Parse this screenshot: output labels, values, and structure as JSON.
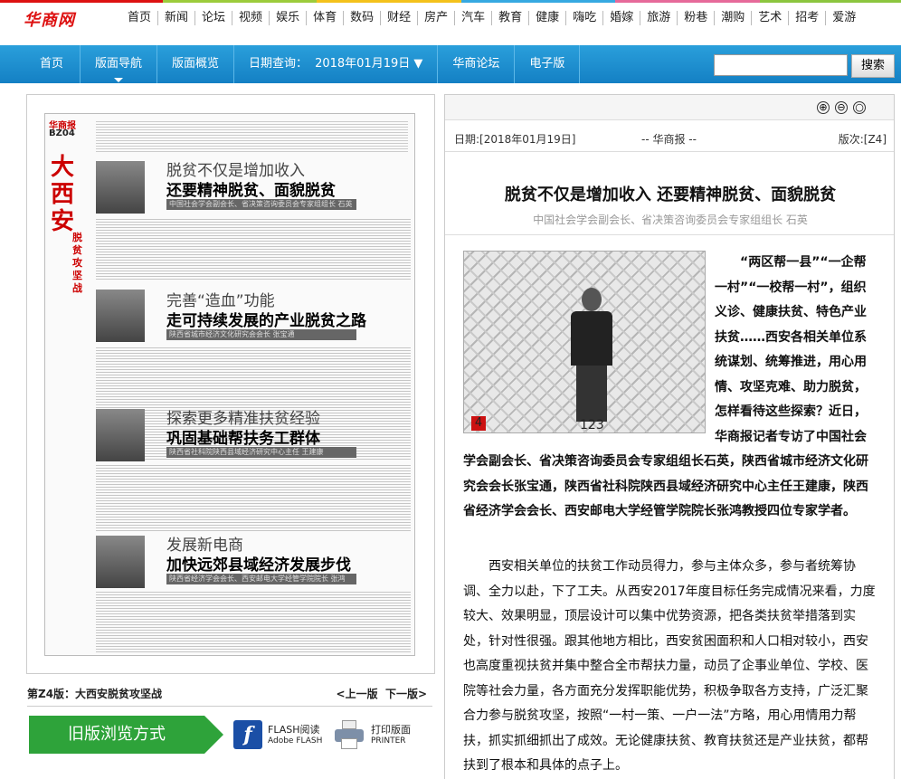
{
  "site": {
    "logo": "华商网",
    "top_nav": [
      "首页",
      "新闻",
      "论坛",
      "视频",
      "娱乐",
      "体育",
      "数码",
      "财经",
      "房产",
      "汽车",
      "教育",
      "健康",
      "嗨吃",
      "婚嫁",
      "旅游",
      "粉巷",
      "潮购",
      "艺术",
      "招考",
      "爱游"
    ]
  },
  "bar": {
    "items": [
      "首页",
      "版面导航",
      "版面概览",
      "日期查询：",
      "2018年01月19日 ▼",
      "华商论坛",
      "电子版"
    ],
    "search_placeholder": "",
    "search_button": "搜索"
  },
  "page": {
    "masthead_logo": "华商报",
    "page_code": "BZ04",
    "masthead_title": "大西安",
    "masthead_sub": "脱贫攻坚战",
    "sections": [
      {
        "kicker": "脱贫不仅是增加收入",
        "headline": "还要精神脱贫、面貌脱贫",
        "band": "中国社会学会副会长、省决策咨询委员会专家组组长 石英"
      },
      {
        "kicker": "完善“造血”功能",
        "headline": "走可持续发展的产业脱贫之路",
        "band": "陕西省城市经济文化研究会会长 张宝通"
      },
      {
        "kicker": "探索更多精准扶贫经验",
        "headline": "巩固基础帮扶务工群体",
        "band": "陕西省社科院陕西县域经济研究中心主任 王建康"
      },
      {
        "kicker": "发展新电商",
        "headline": "加快远郊县域经济发展步伐",
        "band": "陕西省经济学会会长、西安邮电大学经管学院院长 张鸿"
      }
    ],
    "footer_left": "第Z4版：大西安脱贫攻坚战",
    "footer_prev": "<上一版",
    "footer_next": "下一版>"
  },
  "bottom": {
    "old_button": "旧版浏览方式",
    "flash_line1": "FLASH阅读",
    "flash_line2": "Adobe FLASH",
    "print_line1": "打印版面",
    "print_line2": "PRINTER"
  },
  "article": {
    "tools": [
      "⊕",
      "⊖",
      "○"
    ],
    "date": "日期:[2018年01月19日]",
    "paper": "-- 华商报 --",
    "edition": "版次:[Z4]",
    "title": "脱贫不仅是增加收入 还要精神脱贫、面貌脱贫",
    "subtitle": "中国社会学会副会长、省决策咨询委员会专家组组长 石英",
    "photo_num": "4",
    "photo_caption": "123",
    "lead": "“两区帮一县”“一企帮一村”“一校帮一村”，组织义诊、健康扶贫、特色产业扶贫……西安各相关单位系统谋划、统筹推进，用心用情、攻坚克难、助力脱贫，怎样看待这些探索？近日，华商报记者专访了中国社会学会副会长、省决策咨询委员会专家组组长石英，陕西省城市经济文化研究会会长张宝通，陕西省社科院陕西县域经济研究中心主任王建康，陕西省经济学会会长、西安邮电大学经管学院院长张鸿教授四位专家学者。",
    "body": "西安相关单位的扶贫工作动员得力，参与主体众多，参与者统筹协调、全力以赴，下了工夫。从西安2017年度目标任务完成情况来看，力度较大、效果明显，顶层设计可以集中优势资源，把各类扶贫举措落到实处，针对性很强。跟其他地方相比，西安贫困面积和人口相对较小，西安也高度重视扶贫并集中整合全市帮扶力量，动员了企事业单位、学校、医院等社会力量，各方面充分发挥职能优势，积极争取各方支持，广泛汇聚合力参与脱贫攻坚，按照“一村一策、一户一法”方略，用心用情用力帮扶，抓实抓细抓出了成效。无论健康扶贫、教育扶贫还是产业扶贫，都帮扶到了根本和具体的点子上。"
  }
}
